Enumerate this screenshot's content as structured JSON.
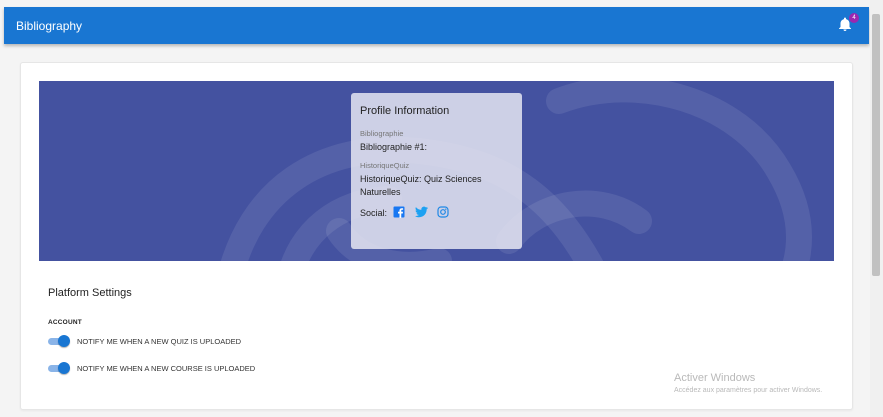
{
  "app": {
    "title": "Bibliography",
    "notification_count": "4"
  },
  "profile": {
    "title": "Profile Information",
    "fields": [
      {
        "label": "Bibliographie",
        "value": "Bibliographie #1:"
      },
      {
        "label": "HistoriqueQuiz",
        "value": "HistoriqueQuiz: Quiz Sciences Naturelles"
      }
    ],
    "social_label": "Social:",
    "social_icons": [
      "facebook-icon",
      "twitter-icon",
      "instagram-icon"
    ]
  },
  "settings": {
    "title": "Platform Settings",
    "section": "ACCOUNT",
    "toggles": [
      {
        "label": "NOTIFY ME WHEN A NEW QUIZ IS UPLOADED",
        "on": true
      },
      {
        "label": "NOTIFY ME WHEN A NEW COURSE IS UPLOADED",
        "on": true
      }
    ]
  },
  "watermark": {
    "title": "Activer Windows",
    "subtitle": "Accédez aux paramètres pour activer Windows."
  },
  "colors": {
    "appbar": "#1976d2",
    "banner": "#4452a0",
    "badge": "#9c27b0",
    "toggle_on": "#1976d2"
  }
}
